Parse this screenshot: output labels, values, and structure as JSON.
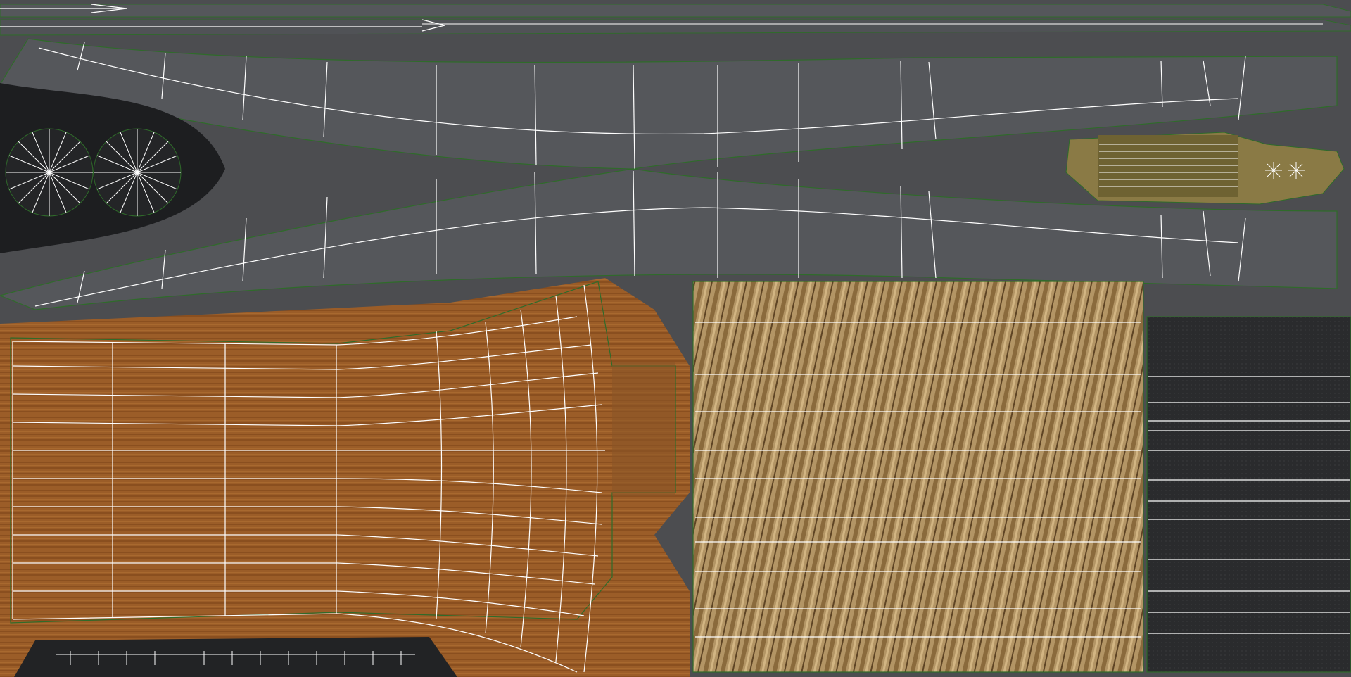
{
  "uv_layout": {
    "background_color": "#4c4d50",
    "wireframe_color": "#ffffff",
    "seam_color": "#2f6b2a",
    "islands": [
      {
        "name": "strap-strip-island",
        "texture": "grey-leather",
        "color": "#55575b"
      },
      {
        "name": "upper-left-band-island",
        "texture": "grey-leather",
        "color": "#55575b"
      },
      {
        "name": "lower-left-band-island",
        "texture": "grey-leather",
        "color": "#55575b"
      },
      {
        "name": "rivet-disc-island",
        "texture": "black-leather",
        "color": "#1d1e20",
        "count": 2
      },
      {
        "name": "buckle-tab-island",
        "texture": "olive-brass",
        "color": "#8a7a45"
      },
      {
        "name": "wood-stock-island",
        "texture": "wood",
        "color": "#9a5c27"
      },
      {
        "name": "bamboo-panel-island",
        "texture": "bamboo",
        "color": "#a8875a"
      },
      {
        "name": "dark-leather-panel-island",
        "texture": "black-leather",
        "color": "#2a2b2d"
      },
      {
        "name": "bottom-rubber-strip-island",
        "texture": "black-leather",
        "color": "#222325"
      }
    ]
  }
}
